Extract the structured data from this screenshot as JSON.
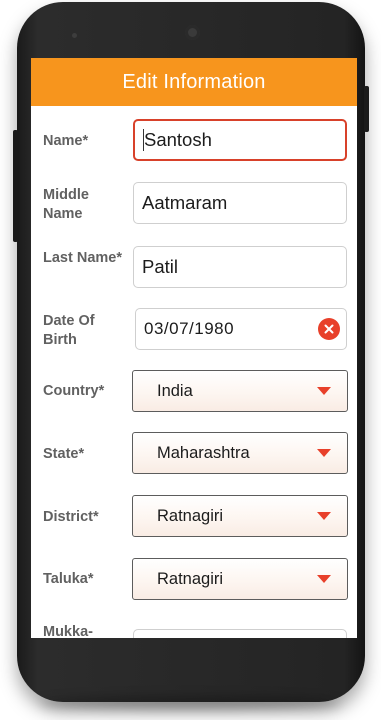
{
  "header": {
    "title": "Edit Information"
  },
  "form": {
    "name": {
      "label": "Name*",
      "value": "Santosh"
    },
    "middle_name": {
      "label": "Middle Name",
      "value": "Aatmaram"
    },
    "last_name": {
      "label": "Last Name*",
      "value": "Patil"
    },
    "dob": {
      "label": "Date Of Birth",
      "value": "03/07/1980"
    },
    "country": {
      "label": "Country*",
      "value": "India"
    },
    "state": {
      "label": "State*",
      "value": "Maharashtra"
    },
    "district": {
      "label": "District*",
      "value": "Ratnagiri"
    },
    "taluka": {
      "label": "Taluka*",
      "value": "Ratnagiri"
    },
    "mukkam": {
      "label": "Mukka-"
    }
  },
  "colors": {
    "accent": "#f7951d",
    "error_red": "#e8402a"
  },
  "icons": {
    "clear": "close-circle-icon",
    "dropdown": "caret-down-icon"
  }
}
